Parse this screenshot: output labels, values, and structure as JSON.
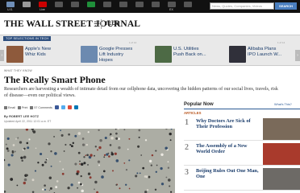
{
  "topbar": {
    "nav": [
      {
        "label": "U.S.",
        "icon": "us-edition-icon",
        "color": "#6f8fb8"
      },
      {
        "label": "",
        "icon": "home-icon",
        "color": "#999"
      },
      {
        "label": "Live",
        "icon": "live-video-icon",
        "color": "#c00"
      },
      {
        "label": "",
        "icon": "subscribe-icon",
        "color": "#555"
      },
      {
        "label": "",
        "icon": "mobile-icon",
        "color": "#555"
      },
      {
        "label": "",
        "icon": "market-data-icon",
        "color": "#1f8f3a"
      },
      {
        "label": "",
        "icon": "blogs-icon",
        "color": "#555"
      },
      {
        "label": "",
        "icon": "wsj-icon",
        "color": "#555"
      },
      {
        "label": "",
        "icon": "tools-icon",
        "color": "#555"
      },
      {
        "label": "",
        "icon": "social-icon",
        "color": "#555"
      },
      {
        "label": "EX",
        "icon": "export-icon",
        "color": "#555"
      },
      {
        "label": "",
        "icon": "tv-icon",
        "color": "#555"
      }
    ],
    "search_placeholder": "News, Quotes, Companies, Videos",
    "search_button": "SEARCH"
  },
  "masthead": {
    "logo": "THE WALL STREET JOURNAL",
    "section": "TECH"
  },
  "strip": {
    "label": "TOP SELECTIONS IN TECH",
    "tiles": [
      {
        "num": "",
        "title": "Apple's New Whiz Kids",
        "thumb": "#8e5a3c"
      },
      {
        "num": "1 of 14",
        "title": "Google Presses Lift Industry Hopes",
        "thumb": "#6c8ab0"
      },
      {
        "num": "",
        "title": "U.S. Utilities Push Back on...",
        "thumb": "#4d6a45"
      },
      {
        "num": "1 of 14",
        "title": "Alibaba Plans IPO Launch W...",
        "thumb": "#30303a"
      }
    ]
  },
  "article": {
    "kicker": "WHAT THEY KNOW",
    "headline": "The Really Smart Phone",
    "dek": "Researchers are harvesting a wealth of intimate detail from our cellphone data, uncovering the hidden patterns of our social lives, travels, risk of disease—even our political views.",
    "tools": [
      {
        "label": "Email",
        "icon": "email-icon"
      },
      {
        "label": "Print",
        "icon": "print-icon"
      },
      {
        "label": "57 Comments",
        "icon": "comments-icon"
      }
    ],
    "social": [
      {
        "icon": "facebook-icon",
        "color": "#3b5998"
      },
      {
        "icon": "twitter-icon",
        "color": "#55acee"
      },
      {
        "icon": "google-plus-icon",
        "color": "#dd4b39"
      },
      {
        "icon": "linkedin-icon",
        "color": "#0077b5"
      }
    ],
    "byline": "By ROBERT LEE HOTZ",
    "date": "Updated April 22, 2011 12:01 a.m. ET"
  },
  "popular": {
    "title": "Popular Now",
    "link": "What's This?",
    "section_label": "ARTICLES",
    "items": [
      {
        "rank": "1",
        "title": "Why Doctors Are Sick of Their Profession",
        "thumb": "#7a6a5a"
      },
      {
        "rank": "2",
        "title": "The Assembly of a New World Order",
        "thumb": "#a93a2c"
      },
      {
        "rank": "3",
        "title": "Beijing Rules Out One Man, One",
        "thumb": "#6d6a66"
      }
    ]
  }
}
